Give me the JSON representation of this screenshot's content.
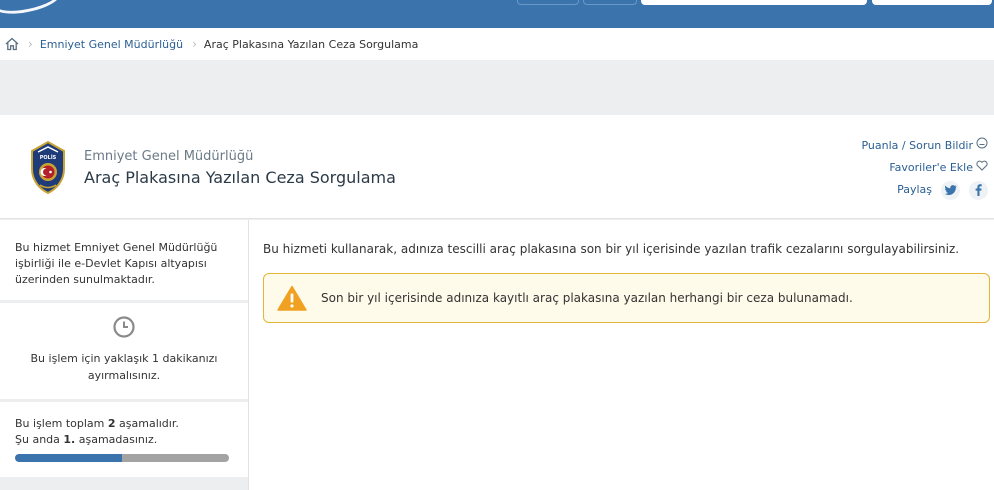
{
  "colors": {
    "header_blue": "#3b74ad",
    "link_blue": "#2b5f93",
    "warning_border": "#e4b53b",
    "warning_icon": "#f0a122",
    "progress_fill": "#3b74ad",
    "progress_track": "#a3a3a3"
  },
  "breadcrumb": {
    "home_icon": "home-icon",
    "items": [
      "Emniyet Genel Müdürlüğü",
      "Araç Plakasına Yazılan Ceza Sorgulama"
    ]
  },
  "service": {
    "logo_icon": "police-emblem",
    "organization": "Emniyet Genel Müdürlüğü",
    "title": "Araç Plakasına Yazılan Ceza Sorgulama",
    "actions": {
      "rate_label": "Puanla / Sorun Bildir",
      "rate_icon": "smiley-icon",
      "favorite_label": "Favoriler'e Ekle",
      "favorite_icon": "heart-icon",
      "share_label": "Paylaş",
      "share_icons": [
        "twitter-icon",
        "facebook-icon"
      ]
    }
  },
  "sidebar": {
    "intro": "Bu hizmet Emniyet Genel Müdürlüğü işbirliği ile e-Devlet Kapısı altyapısı üzerinden sunulmaktadır.",
    "duration_icon": "clock-icon",
    "duration": "Bu işlem için yaklaşık 1 dakikanızı ayırmalısınız.",
    "steps": {
      "total_prefix": "Bu işlem toplam ",
      "total_count": "2",
      "total_suffix": " aşamalıdır.",
      "current_prefix": "Şu anda ",
      "current_step": "1.",
      "current_suffix": " aşamadasınız.",
      "progress": 0.5
    }
  },
  "main": {
    "description": "Bu hizmeti kullanarak, adınıza tescilli araç plakasına son bir yıl içerisinde yazılan trafik cezalarını sorgulayabilirsiniz.",
    "alert": {
      "icon": "warning-icon",
      "message": "Son bir yıl içerisinde adınıza kayıtlı araç plakasına yazılan herhangi bir ceza bulunamadı."
    }
  }
}
